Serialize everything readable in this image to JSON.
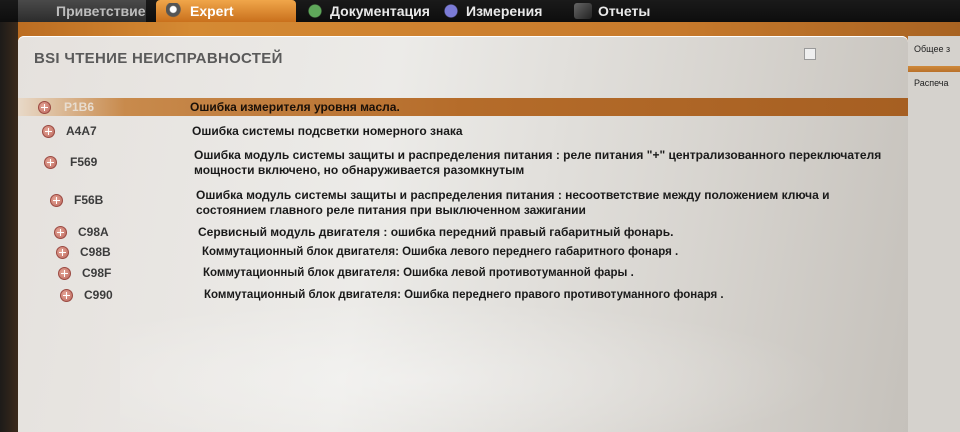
{
  "tabs": [
    {
      "label": "Приветствие"
    },
    {
      "label": "Expert"
    },
    {
      "label": "Документация"
    },
    {
      "label": "Измерения"
    },
    {
      "label": "Отчеты"
    }
  ],
  "panel": {
    "title": "BSI ЧТЕНИЕ НЕИСПРАВНОСТЕЙ"
  },
  "side": {
    "items": [
      "Общее з",
      "Распеча"
    ]
  },
  "faults": [
    {
      "code": "P1B6",
      "description": "Ошибка измерителя уровня масла.",
      "selected": true
    },
    {
      "code": "A4A7",
      "description": "Ошибка системы подсветки номерного знака"
    },
    {
      "code": "F569",
      "description": "Ошибка модуль системы защиты и распределения питания : реле питания \"+\" централизованного переключателя мощности включено, но обнаруживается разомкнутым"
    },
    {
      "code": "F56B",
      "description": "Ошибка модуль системы защиты и распределения питания : несоответствие между положением ключа и состоянием главного реле питания при выключенном зажигании"
    },
    {
      "code": "C98A",
      "description": "Сервисный модуль двигателя : ошибка передний правый габаритный фонарь."
    },
    {
      "code": "C98B",
      "description": "Коммутационный блок двигателя: Ошибка левого переднего габаритного фонаря ."
    },
    {
      "code": "C98F",
      "description": "Коммутационный блок двигателя: Ошибка левой противотуманной фары ."
    },
    {
      "code": "C990",
      "description": "Коммутационный блок двигателя: Ошибка переднего правого противотуманного фонаря ."
    }
  ],
  "colors": {
    "accent": "#c9701c",
    "selected_row": "#b56c2a"
  }
}
